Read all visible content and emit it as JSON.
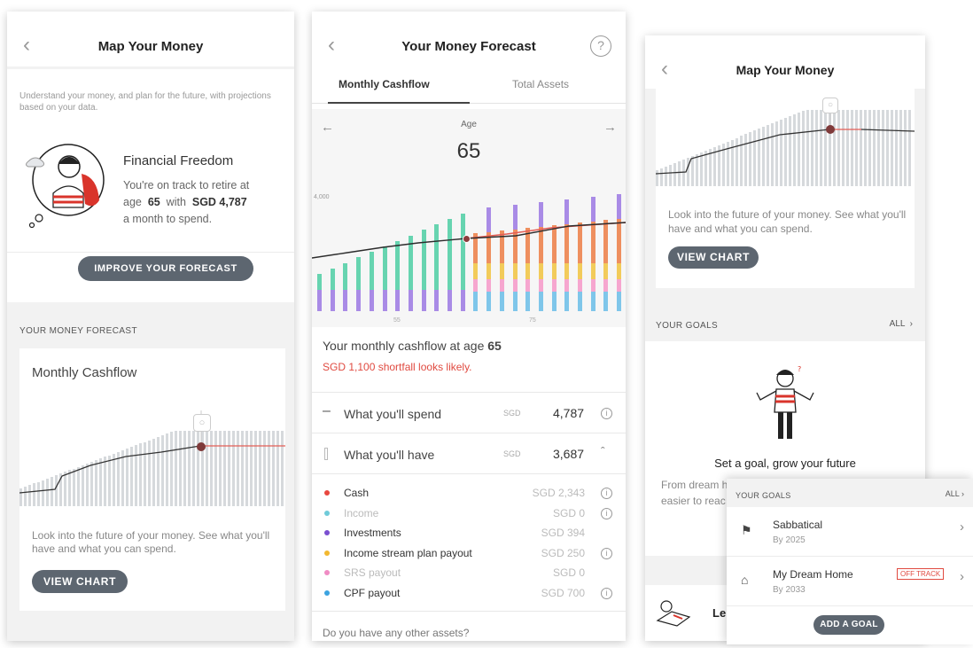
{
  "s1": {
    "title": "Map Your Money",
    "intro": "Understand your money, and plan for the future, with projections based on your data.",
    "ff_title": "Financial Freedom",
    "ff_line1": "You're on track to retire at",
    "ff_age_prefix": "age",
    "ff_age": "65",
    "ff_with": "with",
    "ff_amount": "SGD 4,787",
    "ff_line3": "a month to spend.",
    "improve_btn": "IMPROVE YOUR FORECAST",
    "forecast_label": "YOUR MONEY FORECAST",
    "card_title": "Monthly Cashflow",
    "card_text": "Look into the future of your money. See what you'll have and what you can spend.",
    "view_btn": "VIEW CHART"
  },
  "s2": {
    "title": "Your Money Forecast",
    "tab1": "Monthly Cashflow",
    "tab2": "Total Assets",
    "age_label": "Age",
    "age_value": "65",
    "y_tick": "4,000",
    "x_tick1": "55",
    "x_tick2": "75",
    "cashflow_title_prefix": "Your monthly cashflow at age",
    "cashflow_age": "65",
    "shortfall": "SGD 1,100 shortfall looks likely.",
    "spend_label": "What you'll spend",
    "spend_cur": "SGD",
    "spend_value": "4,787",
    "have_label": "What you'll have",
    "have_cur": "SGD",
    "have_value": "3,687",
    "items": [
      {
        "label": "Cash",
        "value": "SGD 2,343",
        "color": "#e8473f",
        "info": true
      },
      {
        "label": "Income",
        "value": "SGD 0",
        "color": "#6fcbd9",
        "info": true
      },
      {
        "label": "Investments",
        "value": "SGD 394",
        "color": "#7a4fd0",
        "info": false
      },
      {
        "label": "Income stream plan payout",
        "value": "SGD 250",
        "color": "#f2b830",
        "info": true
      },
      {
        "label": "SRS payout",
        "value": "SGD 0",
        "color": "#f08cc4",
        "info": false
      },
      {
        "label": "CPF payout",
        "value": "SGD 700",
        "color": "#3ba3e0",
        "info": true
      }
    ],
    "other_assets": "Do you have any other assets?"
  },
  "s3": {
    "title": "Map Your Money",
    "card_text": "Look into the future of your money. See what you'll have and what you can spend.",
    "view_btn": "VIEW CHART",
    "goals_label": "YOUR GOALS",
    "goals_all": "ALL",
    "set_goal": "Set a goal, grow your future",
    "from_dream": "From dream h",
    "easier": "easier to reac",
    "learn": "Le"
  },
  "s4": {
    "goals_label": "YOUR GOALS",
    "goals_all": "ALL",
    "goals": [
      {
        "name": "Sabbatical",
        "by": "By 2025",
        "icon": "flag-icon",
        "badge": ""
      },
      {
        "name": "My Dream Home",
        "by": "By 2033",
        "icon": "home-icon",
        "badge": "OFF TRACK"
      }
    ],
    "add_btn": "ADD A GOAL"
  },
  "chart_data": [
    {
      "type": "bar",
      "title": "Monthly Cashflow",
      "note": "age series, bars show stacked monthly income sources; line shows monthly spend",
      "ylabel": "",
      "y_tick_labels": [
        "4,000"
      ],
      "x_tick_labels": [
        "55",
        "75"
      ],
      "selected_age": 65,
      "series": [
        {
          "name": "Investments",
          "color": "#a98be6"
        },
        {
          "name": "Income",
          "color": "#67d4b0"
        },
        {
          "name": "Cash",
          "color": "#ee8f5f"
        },
        {
          "name": "CPF payout",
          "color": "#7fc6ea"
        },
        {
          "name": "SRS payout",
          "color": "#f6a6cf"
        },
        {
          "name": "Income stream plan payout",
          "color": "#f2cb5a"
        }
      ]
    }
  ]
}
